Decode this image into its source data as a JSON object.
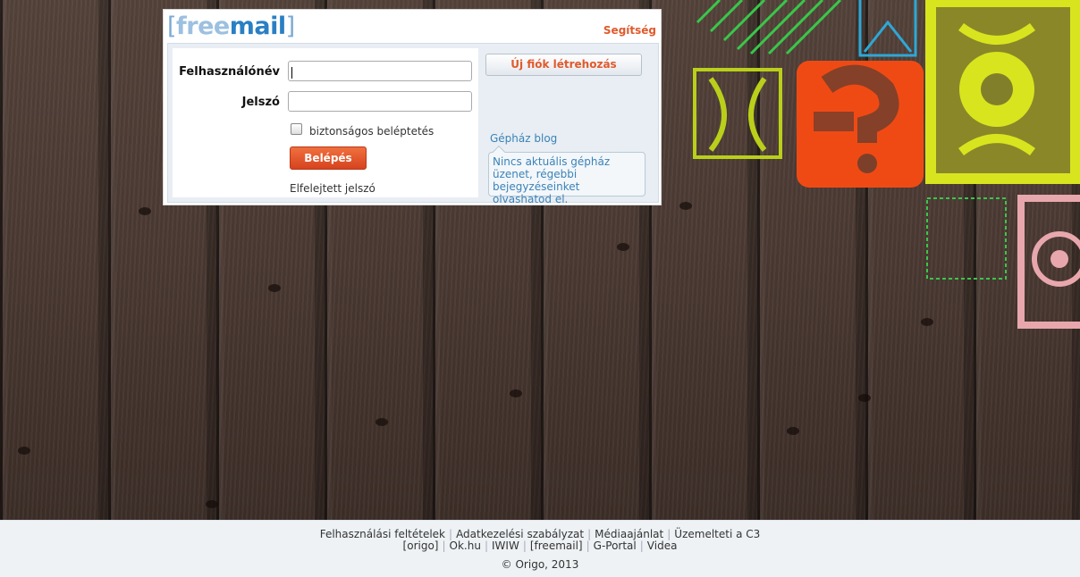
{
  "logo": {
    "bracket_open": "[",
    "free": "free",
    "mail": "mail",
    "bracket_close": "]"
  },
  "header": {
    "help_link": "Segítség"
  },
  "form": {
    "username_label": "Felhasználónév",
    "username_value": "",
    "password_label": "Jelszó",
    "password_value": "",
    "secure_login_label": "biztonságos beléptetés",
    "login_button": "Belépés",
    "forgot_password": "Elfelejtett jelszó"
  },
  "side": {
    "new_account_button": "Új fiók létrehozás",
    "blog_title": "Gépház blog",
    "blog_message": "Nincs aktuális gépház üzenet, régebbi bejegyzéseinket olvashatod el."
  },
  "footer": {
    "links_row1": [
      "Felhasználási feltételek",
      "Adatkezelési szabályzat",
      "Médiaajánlat",
      "Üzemelteti a C3"
    ],
    "links_row2": [
      "[origo]",
      "Ok.hu",
      "IWIW",
      "[freemail]",
      "G-Portal",
      "Videa"
    ],
    "copyright": "© Origo, 2013"
  },
  "colors": {
    "accent_orange": "#e05a2c",
    "link_blue": "#3b82b8",
    "logo_blue": "#2a7fc4"
  }
}
